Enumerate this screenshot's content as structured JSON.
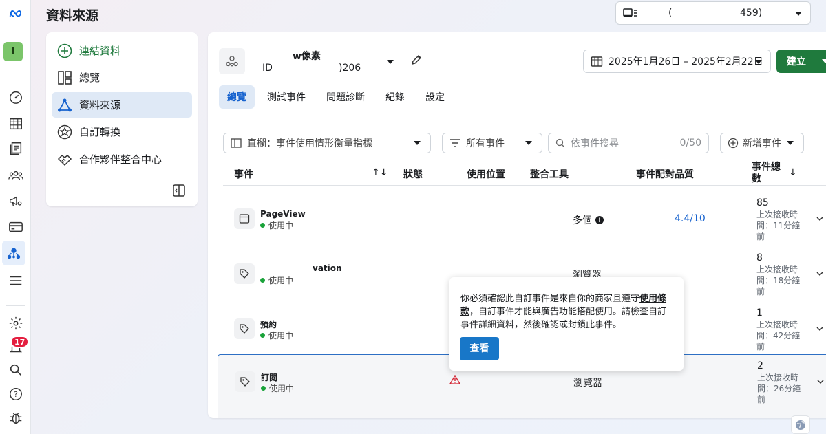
{
  "page": {
    "title": "資料來源"
  },
  "account_selector": {
    "name_part": "(",
    "id_part": "459)"
  },
  "side_nav": {
    "items": [
      {
        "label": "連結資料",
        "icon": "plus-circle-icon"
      },
      {
        "label": "總覽",
        "icon": "layout-icon"
      },
      {
        "label": "資料來源",
        "icon": "network-icon"
      },
      {
        "label": "自訂轉換",
        "icon": "star-badge-icon"
      },
      {
        "label": "合作夥伴整合中心",
        "icon": "handshake-icon"
      }
    ]
  },
  "notifications": {
    "count": "17"
  },
  "pixel": {
    "name": "w像素",
    "id_label": "ID",
    "id_value": ")206"
  },
  "date_range": {
    "label": "2025年1月26日 – 2025年2月22日"
  },
  "create_button": {
    "label": "建立"
  },
  "tabs": [
    {
      "label": "總覽"
    },
    {
      "label": "測試事件"
    },
    {
      "label": "問題診斷"
    },
    {
      "label": "紀錄"
    },
    {
      "label": "設定"
    }
  ],
  "filters": {
    "columns": "直欄：事件使用情形衡量指標",
    "events": "所有事件",
    "search_placeholder": "依事件搜尋",
    "search_count": "0/50",
    "add_event": "新增事件"
  },
  "table": {
    "headers": {
      "event": "事件",
      "sort": "↑↓",
      "status": "狀態",
      "usage": "使用位置",
      "integration": "整合工具",
      "quality": "事件配對品質",
      "total": "事件總數"
    },
    "rows": [
      {
        "name": "PageView",
        "status": "使用中",
        "integration": "多個",
        "quality": "4.4/10",
        "count": "85",
        "last": "上次接收時間：11分鐘前"
      },
      {
        "name": "vation",
        "status": "使用中",
        "integration": "瀏覽器",
        "quality": "",
        "count": "8",
        "last": "上次接收時間：18分鐘前"
      },
      {
        "name": "預約",
        "status": "使用中",
        "integration": "",
        "quality": "",
        "count": "1",
        "last": "上次接收時間：42分鐘前"
      },
      {
        "name": "訂閱",
        "status": "使用中",
        "integration": "瀏覽器",
        "quality": "",
        "count": "2",
        "last": "上次接收時間：26分鐘前"
      }
    ]
  },
  "popup": {
    "text_before": "你必須確認此自訂事件是來自你的商家且遵守",
    "link": "使用條款",
    "text_after": "，自訂事件才能與廣告功能搭配使用。請檢查自訂事件詳細資料，然後確認或封鎖此事件。",
    "button": "查看"
  },
  "colors": {
    "accent_blue": "#1763cf",
    "brand_green": "#1f7a3d",
    "active_bg": "#dfe9f6",
    "alert_red": "#e41e3f"
  }
}
